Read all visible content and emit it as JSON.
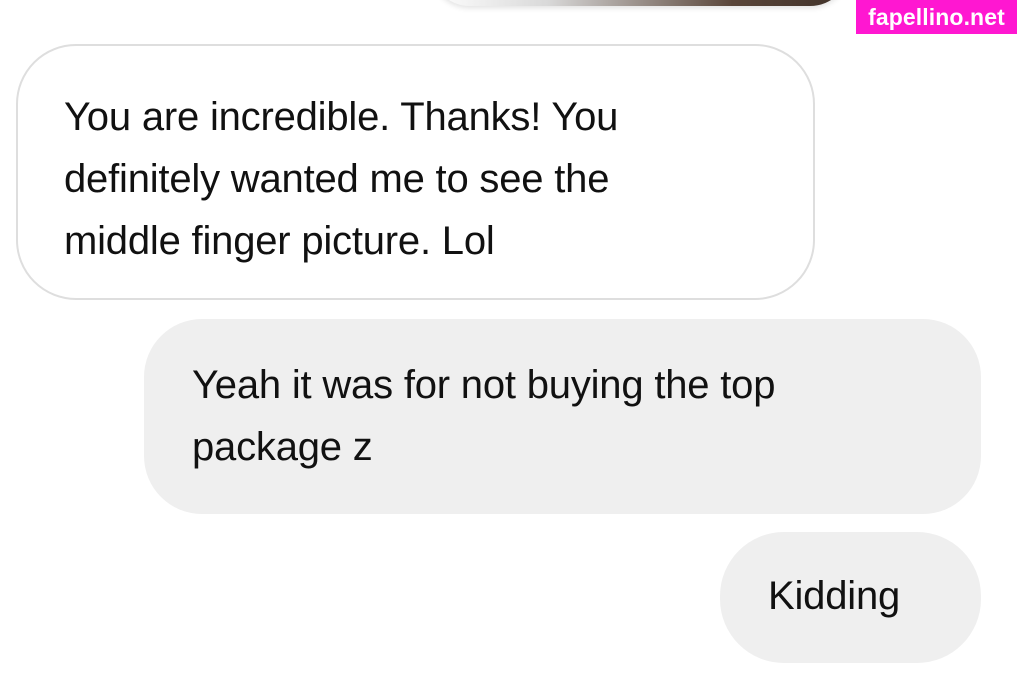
{
  "watermark": {
    "text": "fapellino.net"
  },
  "messages": [
    {
      "direction": "incoming",
      "lines": [
        "You are incredible. Thanks!  You",
        "definitely wanted me to see the",
        "middle finger picture. Lol"
      ]
    },
    {
      "direction": "outgoing",
      "lines": [
        "Yeah it was for not buying the top",
        "package z"
      ]
    },
    {
      "direction": "outgoing",
      "lines": [
        "Kidding"
      ]
    }
  ],
  "colors": {
    "background": "#ffffff",
    "incoming_bubble": "#ffffff",
    "incoming_border": "#dedede",
    "outgoing_bubble": "#efefef",
    "text": "#111111",
    "watermark_background": "#ff17d1",
    "watermark_text": "#ffffff"
  }
}
